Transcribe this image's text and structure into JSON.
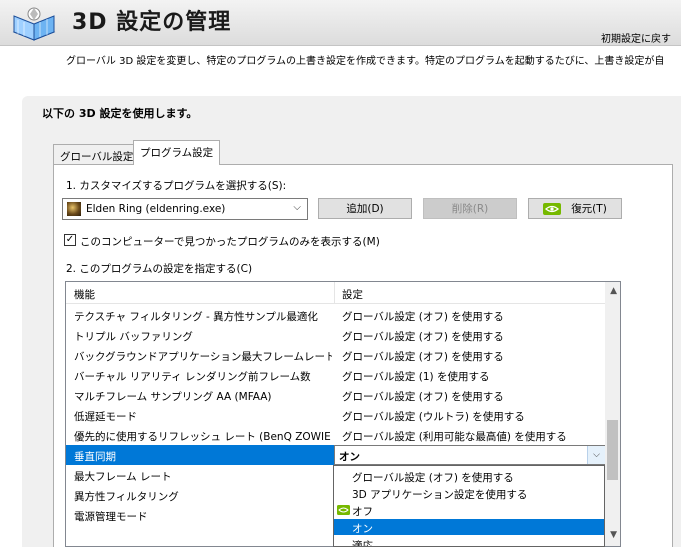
{
  "header": {
    "title": "3D 設定の管理",
    "restore_defaults": "初期設定に戻す"
  },
  "description": "グローバル 3D 設定を変更し、特定のプログラムの上書き設定を作成できます。特定のプログラムを起動するたびに、上書き設定が自",
  "panel": {
    "title": "以下の 3D 設定を使用します。",
    "tabs": [
      {
        "label": "グローバル設定",
        "active": false
      },
      {
        "label": "プログラム設定",
        "active": true
      }
    ]
  },
  "step1": {
    "label": "1. カスタマイズするプログラムを選択する(S):",
    "selected_program": "Elden Ring (eldenring.exe)",
    "buttons": {
      "add": "追加(D)",
      "remove": "削除(R)",
      "restore": "復元(T)"
    },
    "show_only_found_checkbox": {
      "label": "このコンピューターで見つかったプログラムのみを表示する(M)",
      "checked": true,
      "mark": "✓"
    }
  },
  "step2": {
    "label": "2. このプログラムの設定を指定する(C)",
    "columns": {
      "feature": "機能",
      "setting": "設定"
    },
    "rows": [
      {
        "feature": "テクスチャ フィルタリング - 異方性サンプル最適化",
        "setting": "グローバル設定 (オフ) を使用する"
      },
      {
        "feature": "トリプル バッファリング",
        "setting": "グローバル設定 (オフ) を使用する"
      },
      {
        "feature": "バックグラウンドアプリケーション最大フレームレート",
        "setting": "グローバル設定 (オフ) を使用する"
      },
      {
        "feature": "バーチャル リアリティ レンダリング前フレーム数",
        "setting": "グローバル設定 (1) を使用する"
      },
      {
        "feature": "マルチフレーム サンプリング AA (MFAA)",
        "setting": "グローバル設定 (オフ) を使用する"
      },
      {
        "feature": "低遅延モード",
        "setting": "グローバル設定 (ウルトラ) を使用する"
      },
      {
        "feature": "優先的に使用するリフレッシュ レート (BenQ ZOWIE ...",
        "setting": "グローバル設定 (利用可能な最高値) を使用する"
      },
      {
        "feature": "垂直同期",
        "setting": "オン"
      },
      {
        "feature": "最大フレーム レート",
        "setting": ""
      },
      {
        "feature": "異方性フィルタリング",
        "setting": ""
      },
      {
        "feature": "電源管理モード",
        "setting": ""
      }
    ],
    "dropdown_options": [
      {
        "label": "グローバル設定 (オフ) を使用する",
        "highlighted": false
      },
      {
        "label": "3D アプリケーション設定を使用する",
        "highlighted": false
      },
      {
        "label": "オフ",
        "highlighted": false,
        "nvidia_icon": true
      },
      {
        "label": "オン",
        "highlighted": true
      },
      {
        "label": "適応",
        "highlighted": false
      }
    ]
  },
  "colors": {
    "accent": "#0078d7",
    "nvidia_green": "#76b900"
  }
}
